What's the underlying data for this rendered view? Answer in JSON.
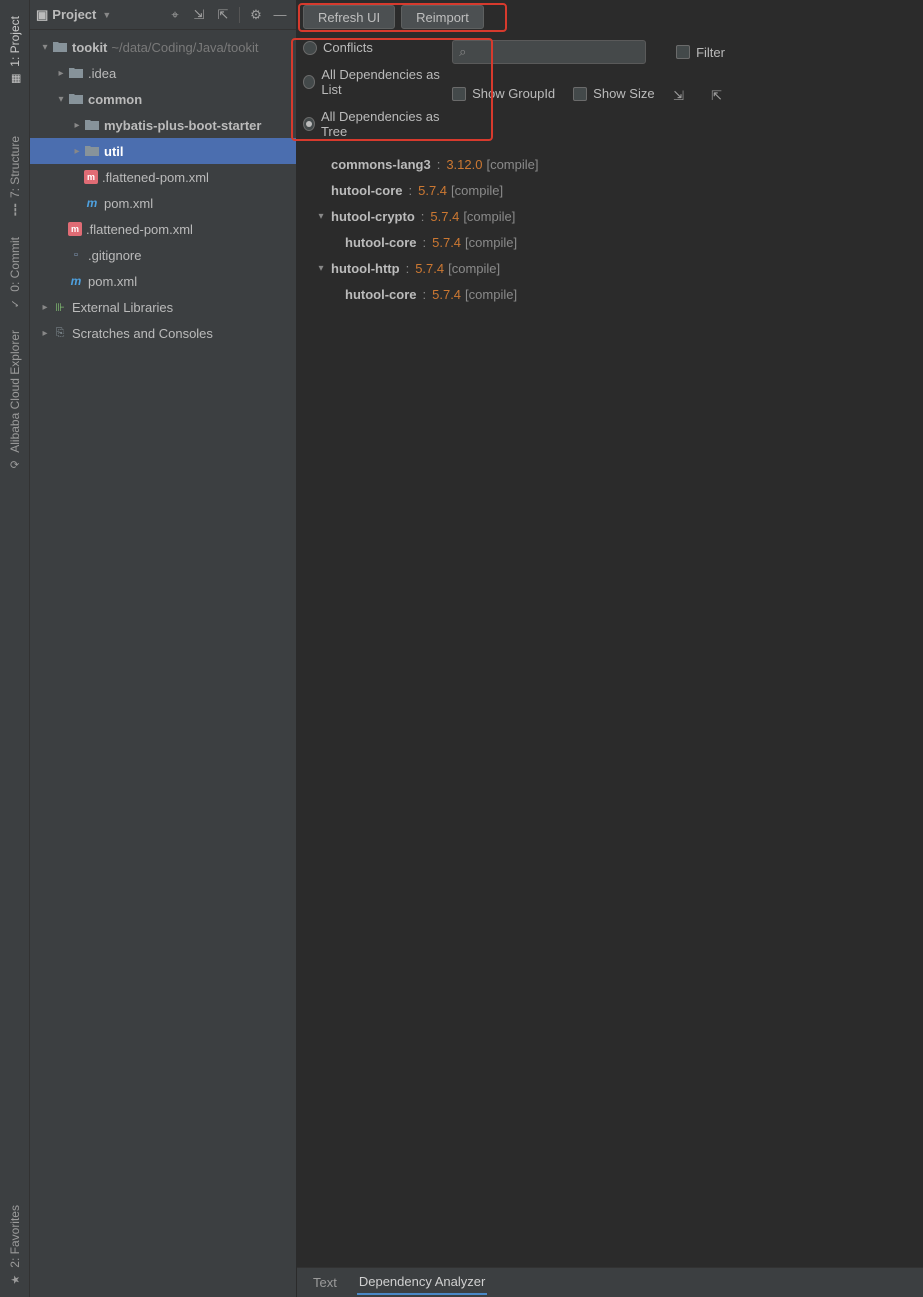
{
  "rail": {
    "tabs": [
      {
        "label": "1: Project",
        "icon": "▦",
        "active": true
      },
      {
        "label": "7: Structure",
        "icon": "┇",
        "active": false
      },
      {
        "label": "0: Commit",
        "icon": "✓",
        "active": false
      },
      {
        "label": "Alibaba Cloud Explorer",
        "icon": "⟳",
        "active": false
      },
      {
        "label": "2: Favorites",
        "icon": "★",
        "active": false
      }
    ]
  },
  "project_header": {
    "title": "Project",
    "icons": {
      "locate": "⌖",
      "expand": "⇲",
      "collapse": "⇱",
      "settings": "⚙",
      "hide": "—"
    }
  },
  "project_tree": [
    {
      "depth": 0,
      "arrow": "▾",
      "icon": "folder",
      "label": "tookit",
      "bold": true,
      "path": "~/data/Coding/Java/tookit"
    },
    {
      "depth": 1,
      "arrow": "▸",
      "icon": "folder",
      "label": ".idea"
    },
    {
      "depth": 1,
      "arrow": "▾",
      "icon": "folder",
      "label": "common",
      "bold": true
    },
    {
      "depth": 2,
      "arrow": "▸",
      "icon": "folder",
      "label": "mybatis-plus-boot-starter",
      "bold": true
    },
    {
      "depth": 2,
      "arrow": "▸",
      "icon": "folder",
      "label": "util",
      "bold": true,
      "selected": true
    },
    {
      "depth": 2,
      "arrow": "",
      "icon": "maven",
      "label": ".flattened-pom.xml"
    },
    {
      "depth": 2,
      "arrow": "",
      "icon": "pom",
      "label": "pom.xml"
    },
    {
      "depth": 1,
      "arrow": "",
      "icon": "maven",
      "label": ".flattened-pom.xml"
    },
    {
      "depth": 1,
      "arrow": "",
      "icon": "file",
      "label": ".gitignore"
    },
    {
      "depth": 1,
      "arrow": "",
      "icon": "pom",
      "label": "pom.xml"
    },
    {
      "depth": 0,
      "arrow": "▸",
      "icon": "lib",
      "label": "External Libraries"
    },
    {
      "depth": 0,
      "arrow": "▸",
      "icon": "scratch",
      "label": "Scratches and Consoles"
    }
  ],
  "buttons": {
    "refresh": "Refresh UI",
    "reimport": "Reimport"
  },
  "view_options": {
    "conflicts": "Conflicts",
    "list": "All Dependencies as List",
    "tree": "All Dependencies as Tree",
    "selected": "tree"
  },
  "controls": {
    "search_icon": "⌕",
    "filter": "Filter",
    "show_groupid": "Show GroupId",
    "show_size": "Show Size",
    "expand_icon": "⇲",
    "collapse_icon": "⇱"
  },
  "dependencies": [
    {
      "depth": 0,
      "arrow": "",
      "name": "commons-lang3",
      "ver": "3.12.0",
      "scope": "[compile]"
    },
    {
      "depth": 0,
      "arrow": "",
      "name": "hutool-core",
      "ver": "5.7.4",
      "scope": "[compile]"
    },
    {
      "depth": 0,
      "arrow": "▾",
      "name": "hutool-crypto",
      "ver": "5.7.4",
      "scope": "[compile]"
    },
    {
      "depth": 1,
      "arrow": "",
      "name": "hutool-core",
      "ver": "5.7.4",
      "scope": "[compile]"
    },
    {
      "depth": 0,
      "arrow": "▾",
      "name": "hutool-http",
      "ver": "5.7.4",
      "scope": "[compile]"
    },
    {
      "depth": 1,
      "arrow": "",
      "name": "hutool-core",
      "ver": "5.7.4",
      "scope": "[compile]"
    }
  ],
  "bottom_tabs": {
    "text": "Text",
    "analyzer": "Dependency Analyzer",
    "active": "analyzer"
  }
}
